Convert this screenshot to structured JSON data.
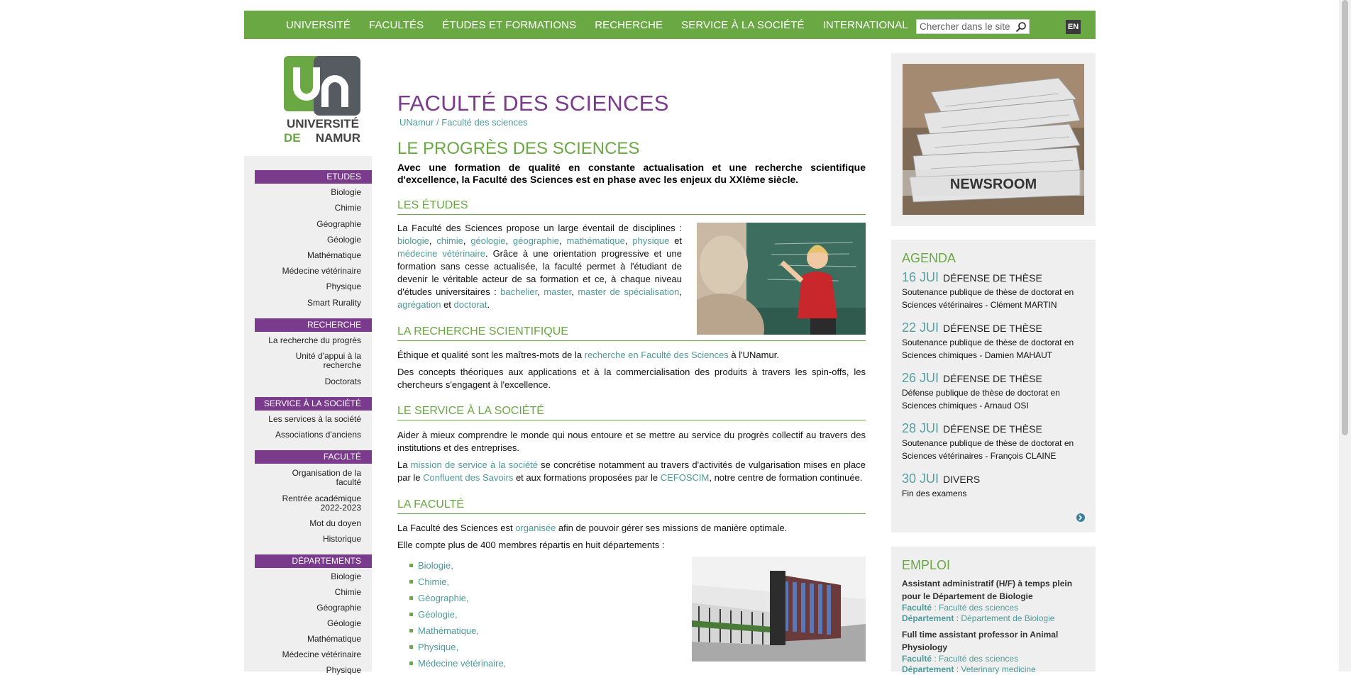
{
  "topnav": {
    "items": [
      "UNIVERSITÉ",
      "FACULTÉS",
      "ÉTUDES ET FORMATIONS",
      "RECHERCHE",
      "SERVICE À LA SOCIÉTÉ",
      "INTERNATIONAL"
    ],
    "search_placeholder": "Chercher dans le site",
    "lang": "EN"
  },
  "logo": {
    "line1": "UNIVERSITÉ",
    "line2_a": "DE",
    "line2_b": "NAMUR"
  },
  "sidebar": {
    "sections": [
      {
        "title": "ETUDES",
        "items": [
          "Biologie",
          "Chimie",
          "Géographie",
          "Géologie",
          "Mathématique",
          "Médecine vétérinaire",
          "Physique",
          "Smart Rurality"
        ]
      },
      {
        "title": "RECHERCHE",
        "items": [
          "La recherche du progrès",
          "Unité d'appui à la recherche",
          "Doctorats"
        ]
      },
      {
        "title": "SERVICE À LA SOCIÉTÉ",
        "items": [
          "Les services à la société",
          "Associations d'anciens"
        ]
      },
      {
        "title": "FACULTÉ",
        "items": [
          "Organisation de la faculté",
          "Rentrée académique 2022-2023",
          "Mot du doyen",
          "Historique"
        ]
      },
      {
        "title": "DÉPARTEMENTS",
        "items": [
          "Biologie",
          "Chimie",
          "Géographie",
          "Géologie",
          "Mathématique",
          "Médecine vétérinaire",
          "Physique"
        ]
      }
    ]
  },
  "main": {
    "title": "FACULTÉ DES SCIENCES",
    "breadcrumb": [
      "UNamur",
      "Faculté des sciences"
    ],
    "breadcrumb_sep": "/",
    "heading": "LE PROGRÈS DES SCIENCES",
    "intro": "Avec une formation de qualité en constante actualisation et une recherche scientifique d'excellence, la Faculté des Sciences est en phase avec les enjeux du XXIème siècle.",
    "etudes": {
      "title": "LES ÉTUDES",
      "t1": "La Faculté des Sciences propose un large éventail de disciplines : ",
      "l_bio": "biologie",
      "l_chi": "chimie",
      "l_geol": "géologie",
      "l_geog": "géographie",
      "l_math": "mathématique",
      "l_phys": "physique",
      "t_et": " et ",
      "l_med": "médecine vétérinaire",
      "t2": ". Grâce à une orientation progressive et une formation sans cesse actualisée, la faculté permet à l'étudiant de devenir le véritable acteur de sa formation et ce, à chaque niveau d'études universitaires : ",
      "l_bach": "bachelier",
      "l_master": "master",
      "l_spec": "master de spécialisation",
      "l_agreg": "agrégation",
      "t_et2": " et ",
      "l_doct": "doctorat",
      "t_end": "."
    },
    "recherche": {
      "title": "LA RECHERCHE SCIENTIFIQUE",
      "p1a": "Éthique et qualité sont les maîtres-mots de la ",
      "p1link": "recherche en Faculté des Sciences",
      "p1b": " à l'UNamur.",
      "p2": "Des concepts théoriques aux applications et à la commercialisation des produits à travers les spin-offs, les chercheurs s'engagent à l'excellence."
    },
    "service": {
      "title": "LE SERVICE À LA SOCIÉTÉ",
      "p1": "Aider à mieux comprendre le monde qui nous entoure et se mettre au service du progrès collectif au travers des institutions et des entreprises.",
      "p2a": "La ",
      "p2link1": "mission de service à la société",
      "p2b": " se concrétise notamment au travers d'activités de vulgarisation mises en place par le ",
      "p2link2": "Confluent des Savoirs",
      "p2c": " et aux formations proposées par le ",
      "p2link3": "CEFOSCIM",
      "p2d": ", notre centre de formation continuée."
    },
    "faculte": {
      "title": "LA FACULTÉ",
      "p1a": "La Faculté des Sciences est ",
      "p1link": "organisée",
      "p1b": " afin de pouvoir gérer ses missions de manière optimale.",
      "p2": "Elle compte plus de 400 membres répartis en huit départements :",
      "departments": [
        "Biologie,",
        "Chimie,",
        "Géographie,",
        "Géologie,",
        "Mathématique,",
        "Physique,",
        "Médecine vétérinaire,"
      ]
    }
  },
  "newsroom": {
    "label": "NEWSROOM"
  },
  "agenda": {
    "title": "AGENDA",
    "events": [
      {
        "date": "16 JUI",
        "type": "DÉFENSE DE THÈSE",
        "desc": "Soutenance publique de thèse de doctorat en Sciences vétérinaires - Clément MARTIN"
      },
      {
        "date": "22 JUI",
        "type": "DÉFENSE DE THÈSE",
        "desc": "Soutenance publique de thèse de doctorat en Sciences chimiques - Damien MAHAUT"
      },
      {
        "date": "26 JUI",
        "type": "DÉFENSE DE THÈSE",
        "desc": "Défense publique de thèse de doctorat en Sciences chimiques - Arnaud OSI"
      },
      {
        "date": "28 JUI",
        "type": "DÉFENSE DE THÈSE",
        "desc": "Soutenance publique de thèse de doctorat en Sciences vétérinaires - François CLAINE"
      },
      {
        "date": "30 JUI",
        "type": "DIVERS",
        "desc": "Fin des examens"
      }
    ]
  },
  "emploi": {
    "title": "EMPLOI",
    "jobs": [
      {
        "title": "Assistant administratif (H/F) à temps plein pour le Département de Biologie",
        "fac_label": "Faculté",
        "fac": " : Faculté des sciences",
        "dep_label": "Département",
        "dep": " : Département de Biologie"
      },
      {
        "title": "Full time assistant professor in Animal Physiology",
        "fac_label": "Faculté",
        "fac": " : Faculté des sciences",
        "dep_label": "Département",
        "dep": " : Veterinary medicine"
      }
    ]
  },
  "colors": {
    "green": "#6aa843",
    "purple": "#7a3b8c",
    "teal_link": "#4f9a9a"
  }
}
